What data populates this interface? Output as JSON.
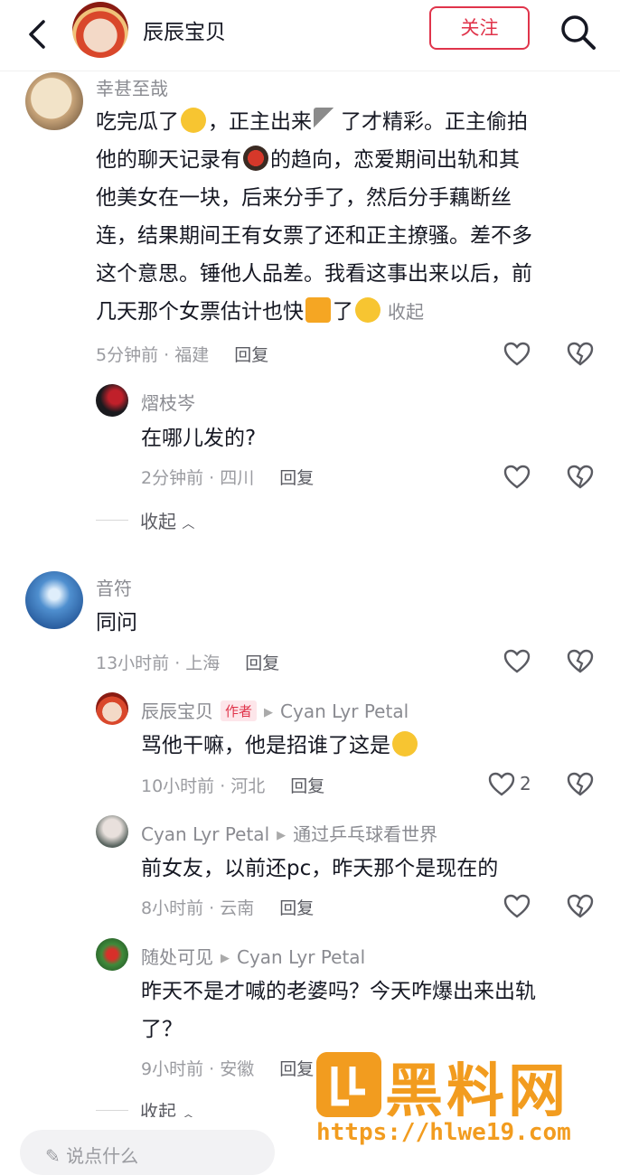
{
  "header": {
    "title": "辰辰宝贝",
    "follow_label": "关注"
  },
  "comments": [
    {
      "user": "幸甚至哉",
      "text_lines": [
        "吃完瓜了",
        "，正主出来",
        "了才精彩。正主偷拍",
        "他的聊天记录有",
        "的趋向，恋爱期间出轨和其",
        "他美女在一块，后来分手了，然后分手藕断丝",
        "连，结果期间王有女票了还和正主撩骚。差不多",
        "这个意思。锤他人品差。我看这事出来以后，前",
        "几天那个女票估计也快",
        "了"
      ],
      "collapse_inline": "收起",
      "meta": "5分钟前 · 福建",
      "reply_label": "回复"
    },
    {
      "user": "熠枝岑",
      "text": "在哪儿发的?",
      "meta": "2分钟前 · 四川",
      "reply_label": "回复"
    },
    {
      "user": "音符",
      "text": "同问",
      "meta": "13小时前 · 上海",
      "reply_label": "回复"
    },
    {
      "user": "辰辰宝贝",
      "badge": "作者",
      "reply_to": "Cyan Lyr Petal",
      "text": "骂他干嘛，他是招谁了这是",
      "meta": "10小时前 · 河北",
      "reply_label": "回复",
      "likes": "2"
    },
    {
      "user": "Cyan Lyr Petal",
      "reply_to": "通过乒乓球看世界",
      "text": "前女友，以前还pc，昨天那个是现在的",
      "meta": "8小时前 · 云南",
      "reply_label": "回复"
    },
    {
      "user": "随处可见",
      "reply_to": "Cyan Lyr Petal",
      "text_lines": [
        "昨天不是才喊的老婆吗？今天咋爆出来出轨",
        "了？"
      ],
      "meta": "9小时前 · 安徽",
      "reply_label": "回复"
    }
  ],
  "collapse_label": "收起",
  "bottom": {
    "input_placeholder": "说点什么"
  },
  "watermark": {
    "title": "黑料网",
    "url": "https://hlwe19.com"
  }
}
